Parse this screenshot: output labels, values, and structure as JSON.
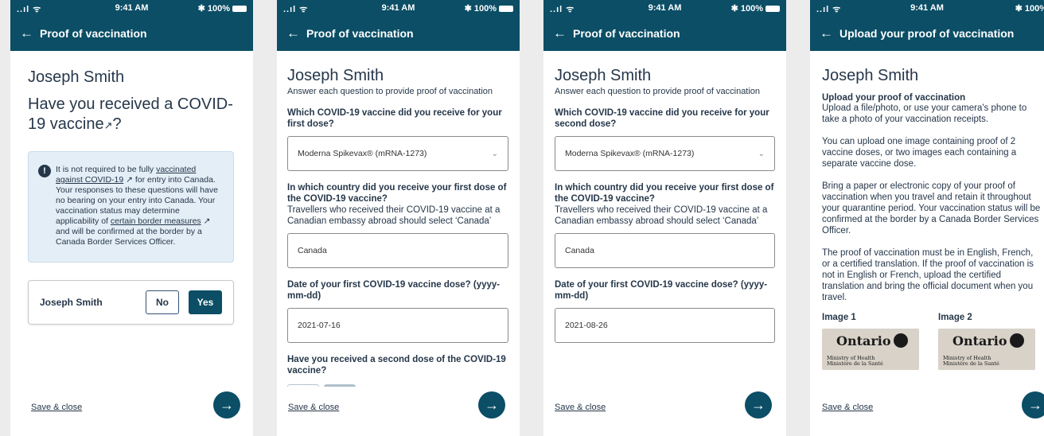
{
  "status": {
    "signal": "..ıl ᯤ",
    "time": "9:41 AM",
    "battery": "✱ 100%"
  },
  "screen1": {
    "app_title": "Proof of vaccination",
    "name": "Joseph Smith",
    "question": "Have you received a COVID-19 vaccine",
    "question_suffix": "?",
    "alert_parts": {
      "p1": "It is not required to be fully ",
      "link1": "vaccinated against COVID-19",
      "p2": " for entry into Canada. Your responses to these questions will have no bearing on your entry into Canada. Your vaccination status may determine applicability of ",
      "link2": "certain border measures",
      "p3": " and will be confirmed at the border by a Canada Border Services Officer."
    },
    "row_label": "Joseph Smith",
    "no_label": "No",
    "yes_label": "Yes",
    "save_close": "Save & close"
  },
  "screen2": {
    "app_title": "Proof of vaccination",
    "name": "Joseph Smith",
    "subtitle": "Answer each question to provide proof of vaccination",
    "q1": "Which COVID-19 vaccine did you receive for your first dose?",
    "q1_value": "Moderna Spikevax® (mRNA-1273)",
    "q2": "In which country did you receive your first dose of the COVID-19 vaccine?",
    "q2_hint": "Travellers who received their COVID-19 vaccine at a Canadian embassy abroad should select ‘Canada’",
    "q2_value": "Canada",
    "q3": "Date of your first COVID-19 vaccine dose? (yyyy-mm-dd)",
    "q3_value": "2021-07-16",
    "q4": "Have you received a second dose of the COVID-19 vaccine?",
    "save_close": "Save & close"
  },
  "screen3": {
    "app_title": "Proof of vaccination",
    "name": "Joseph Smith",
    "subtitle": "Answer each question to provide proof of vaccination",
    "q1": "Which COVID-19 vaccine did you receive for your second dose?",
    "q1_value": "Moderna Spikevax® (mRNA-1273)",
    "q2": "In which country did you receive your first dose of the COVID-19 vaccine?",
    "q2_hint": "Travellers who received their COVID-19 vaccine at a Canadian embassy abroad should select ‘Canada’",
    "q2_value": "Canada",
    "q3": "Date of your first COVID-19 vaccine dose? (yyyy-mm-dd)",
    "q3_value": "2021-08-26",
    "save_close": "Save & close"
  },
  "screen4": {
    "app_title": "Upload your proof of vaccination",
    "name": "Joseph Smith",
    "heading": "Upload your proof of vaccination",
    "p1": "Upload a file/photo, or use your camera's phone to take a photo of your vaccination receipts.",
    "p2": "You can upload one image containing proof of 2 vaccine doses, or two images each containing a separate vaccine dose.",
    "p3": "Bring a paper or electronic copy of your proof of vaccination when you travel and retain it throughout your quarantine period. Your vaccination status will be confirmed at the border by a Canada Border Services Officer.",
    "p4": "The proof of vaccination must be in English, French, or a certified translation. If the proof of vaccination is not in English or French, upload the certified translation and bring the official document when you travel.",
    "image1_label": "Image 1",
    "image2_label": "Image 2",
    "thumb_title": "Ontario",
    "thumb_sub1": "Ministry of Health",
    "thumb_sub2": "Ministère de la Santé",
    "save_close": "Save & close"
  },
  "colors": {
    "header": "#0b4e66",
    "text": "#26374a",
    "alert_bg": "#e4eef6"
  },
  "icons": {
    "back": "arrow-left-icon",
    "next": "arrow-right-icon",
    "external": "external-link-icon",
    "info": "info-icon",
    "chevron": "chevron-down-icon"
  }
}
